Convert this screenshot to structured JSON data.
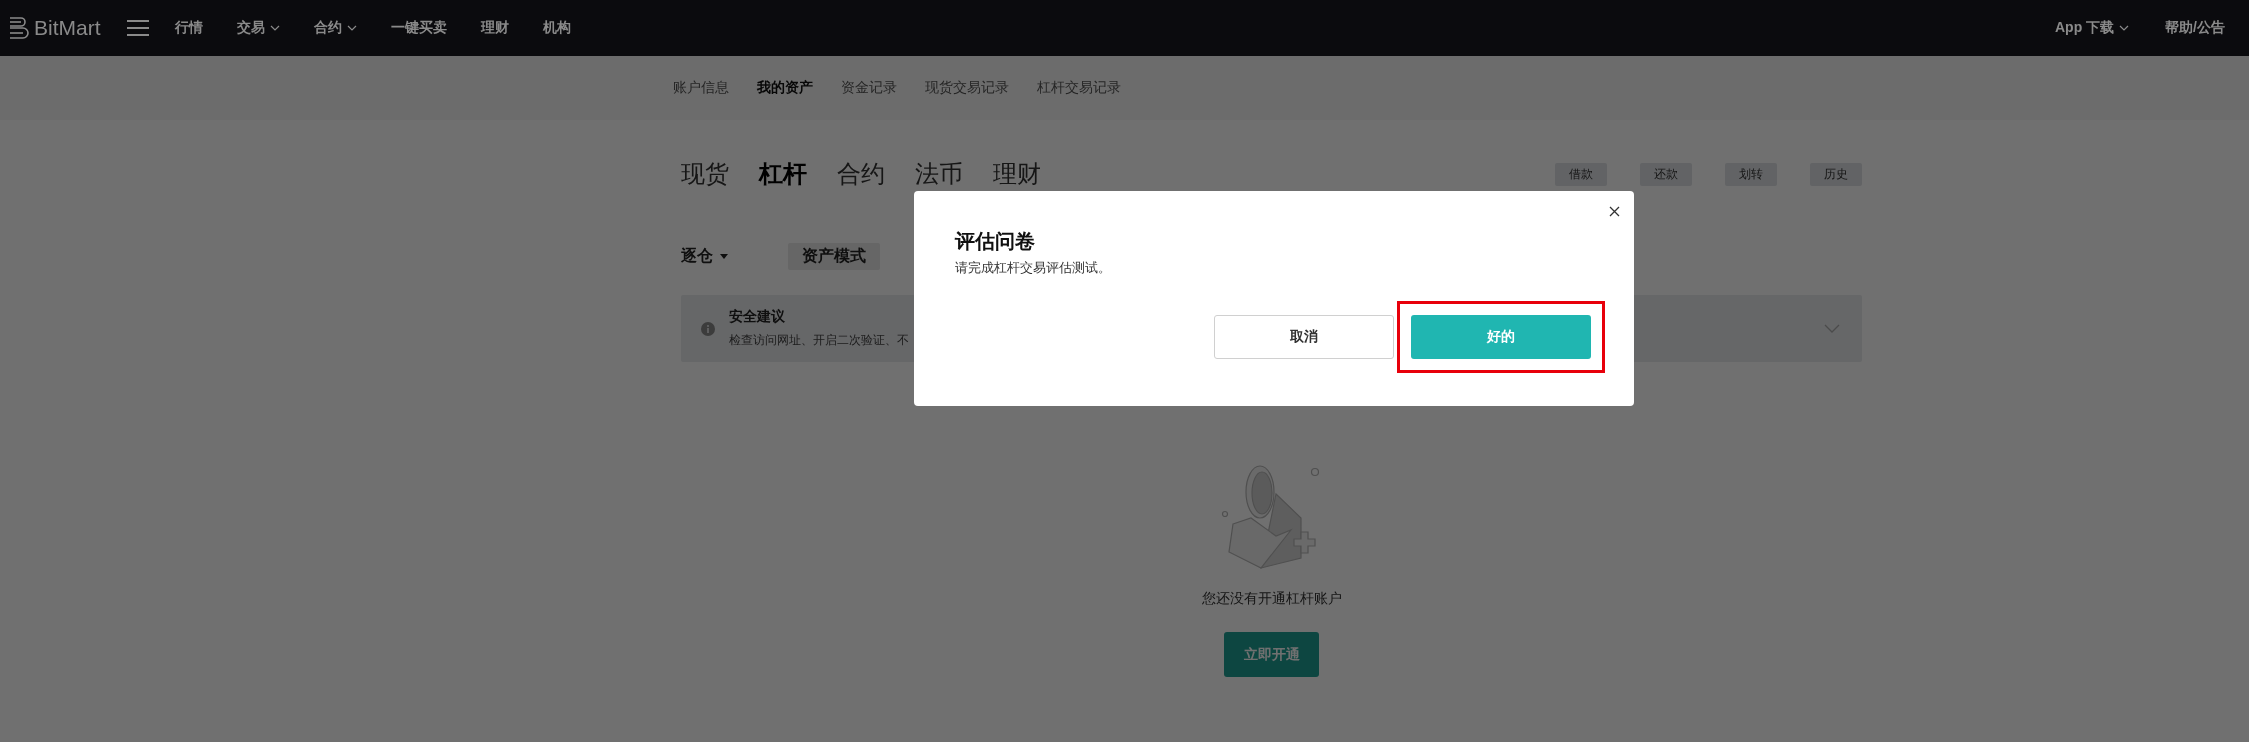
{
  "top_nav": {
    "logo": "BitMart",
    "items": [
      {
        "label": "行情",
        "dropdown": false
      },
      {
        "label": "交易",
        "dropdown": true
      },
      {
        "label": "合约",
        "dropdown": true
      },
      {
        "label": "一键买卖",
        "dropdown": false
      },
      {
        "label": "理财",
        "dropdown": false
      },
      {
        "label": "机构",
        "dropdown": false
      }
    ],
    "right_items": [
      {
        "label": "App 下载",
        "dropdown": true
      },
      {
        "label": "帮助/公告",
        "dropdown": false
      }
    ]
  },
  "sub_nav": [
    {
      "label": "账户信息",
      "selected": false
    },
    {
      "label": "我的资产",
      "selected": true
    },
    {
      "label": "资金记录",
      "selected": false
    },
    {
      "label": "现货交易记录",
      "selected": false
    },
    {
      "label": "杠杆交易记录",
      "selected": false
    }
  ],
  "asset_tabs": [
    {
      "label": "现货",
      "selected": false
    },
    {
      "label": "杠杆",
      "selected": true
    },
    {
      "label": "合约",
      "selected": false
    },
    {
      "label": "法币",
      "selected": false
    },
    {
      "label": "理财",
      "selected": false
    }
  ],
  "actions": [
    "借款",
    "还款",
    "划转",
    "历史"
  ],
  "margin_mode": {
    "label": "逐仓"
  },
  "asset_mode": {
    "label": "资产模式"
  },
  "notice": {
    "title": "安全建议",
    "text": "检查访问网址、开启二次验证、不"
  },
  "empty_state": {
    "message": "您还没有开通杠杆账户",
    "button": "立即开通"
  },
  "dialog": {
    "title": "评估问卷",
    "message": "请完成杠杆交易评估测试。",
    "buttons": [
      {
        "label": "取消",
        "kind": "secondary",
        "highlighted": false
      },
      {
        "label": "好的",
        "kind": "primary",
        "highlighted": true
      }
    ]
  }
}
